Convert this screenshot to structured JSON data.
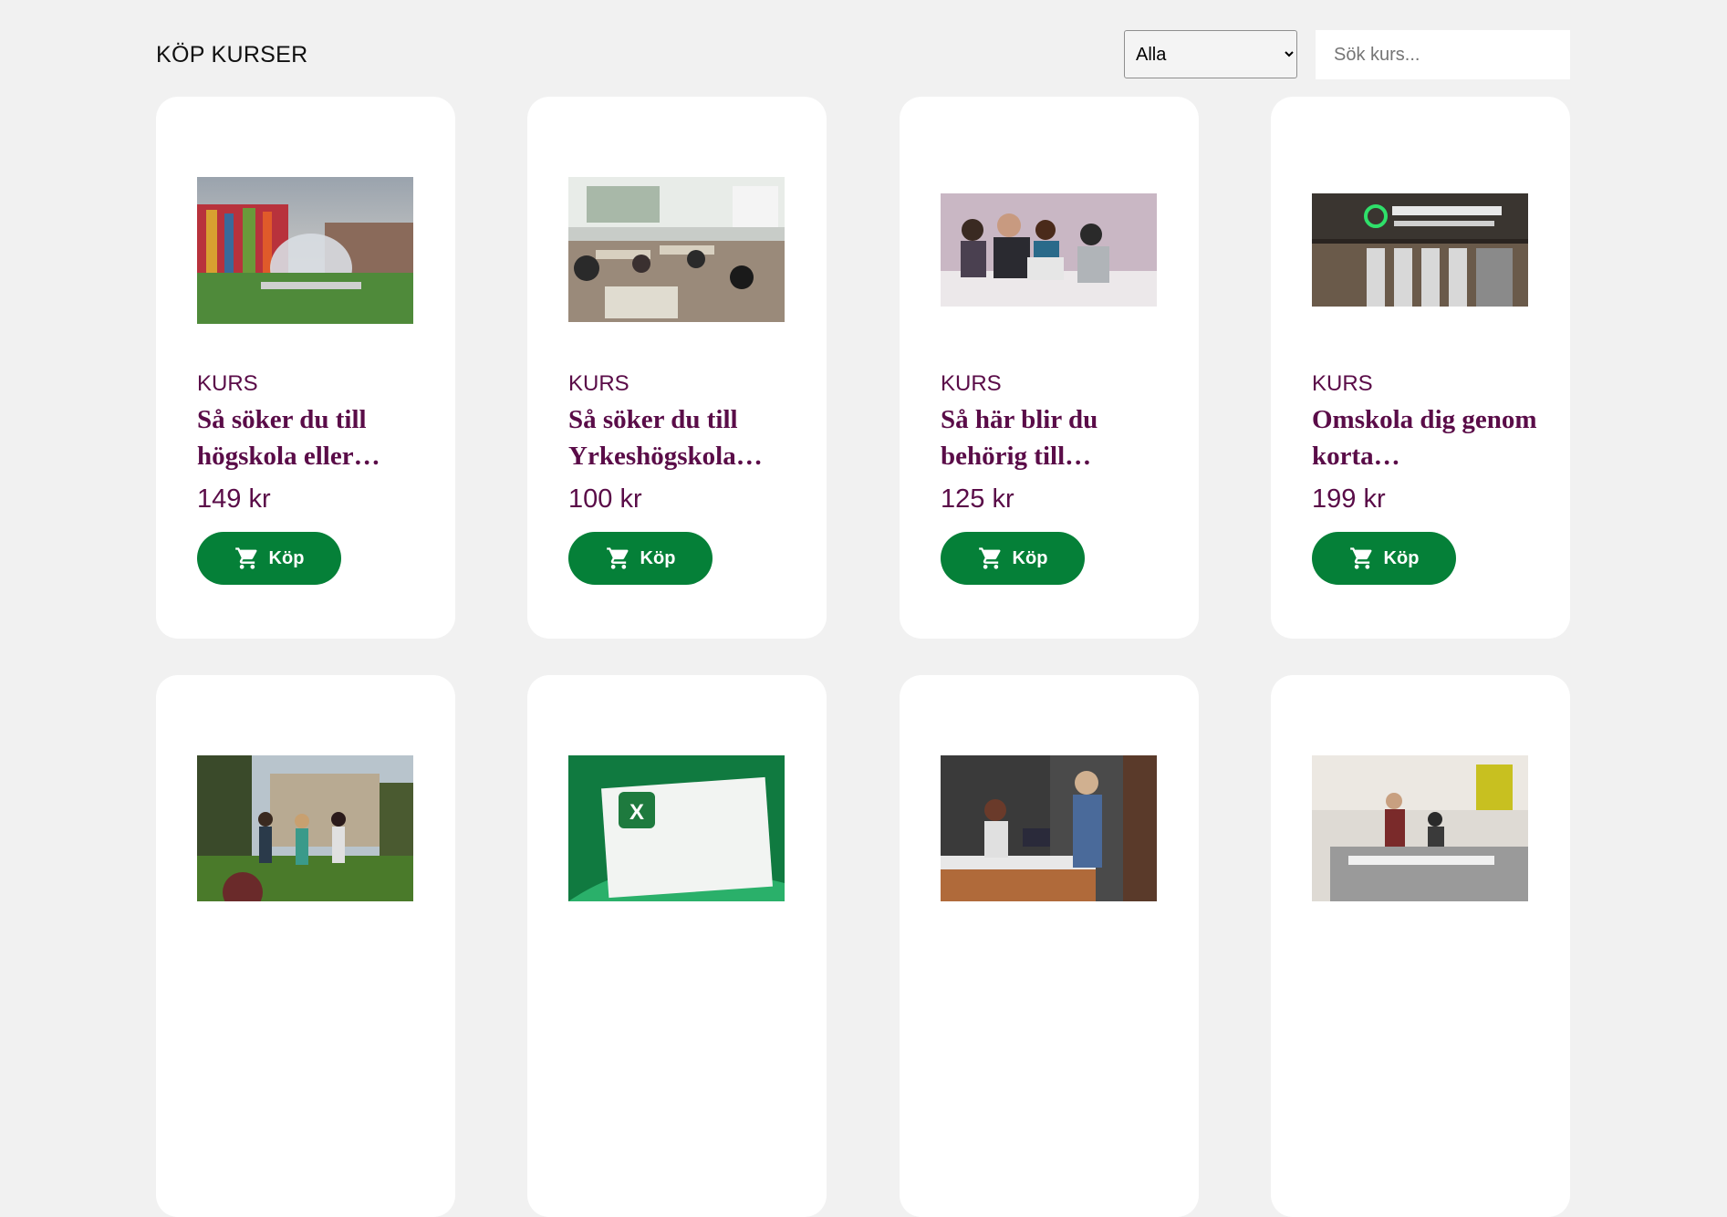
{
  "header": {
    "title": "KÖP KURSER",
    "filter": {
      "selected": "Alla",
      "options": [
        "Alla"
      ]
    },
    "search": {
      "placeholder": "Sök kurs..."
    }
  },
  "colors": {
    "brand_purple": "#5a0c48",
    "buy_green": "#058038",
    "page_bg": "#f1f1f1"
  },
  "cards": [
    {
      "kind": "KURS",
      "title": "Så söker du till högskola eller…",
      "price": "149 kr",
      "buy_label": "Köp",
      "image": "university-campus-dome-photo"
    },
    {
      "kind": "KURS",
      "title": "Så söker du till Yrkeshögskola…",
      "price": "100 kr",
      "buy_label": "Köp",
      "image": "classroom-students-photo"
    },
    {
      "kind": "KURS",
      "title": "Så här blir du behörig till…",
      "price": "125 kr",
      "buy_label": "Köp",
      "image": "group-meeting-laptop-photo"
    },
    {
      "kind": "KURS",
      "title": "Omskola dig genom korta…",
      "price": "199 kr",
      "buy_label": "Köp",
      "image": "arbetsformedlingen-entrance-photo"
    },
    {
      "kind": "",
      "title": "",
      "price": "",
      "buy_label": "",
      "image": "students-on-lawn-photo"
    },
    {
      "kind": "",
      "title": "",
      "price": "",
      "buy_label": "",
      "image": "excel-logo-image"
    },
    {
      "kind": "",
      "title": "",
      "price": "",
      "buy_label": "",
      "image": "reception-desk-photo"
    },
    {
      "kind": "",
      "title": "",
      "price": "",
      "buy_label": "",
      "image": "workshop-people-photo"
    }
  ]
}
